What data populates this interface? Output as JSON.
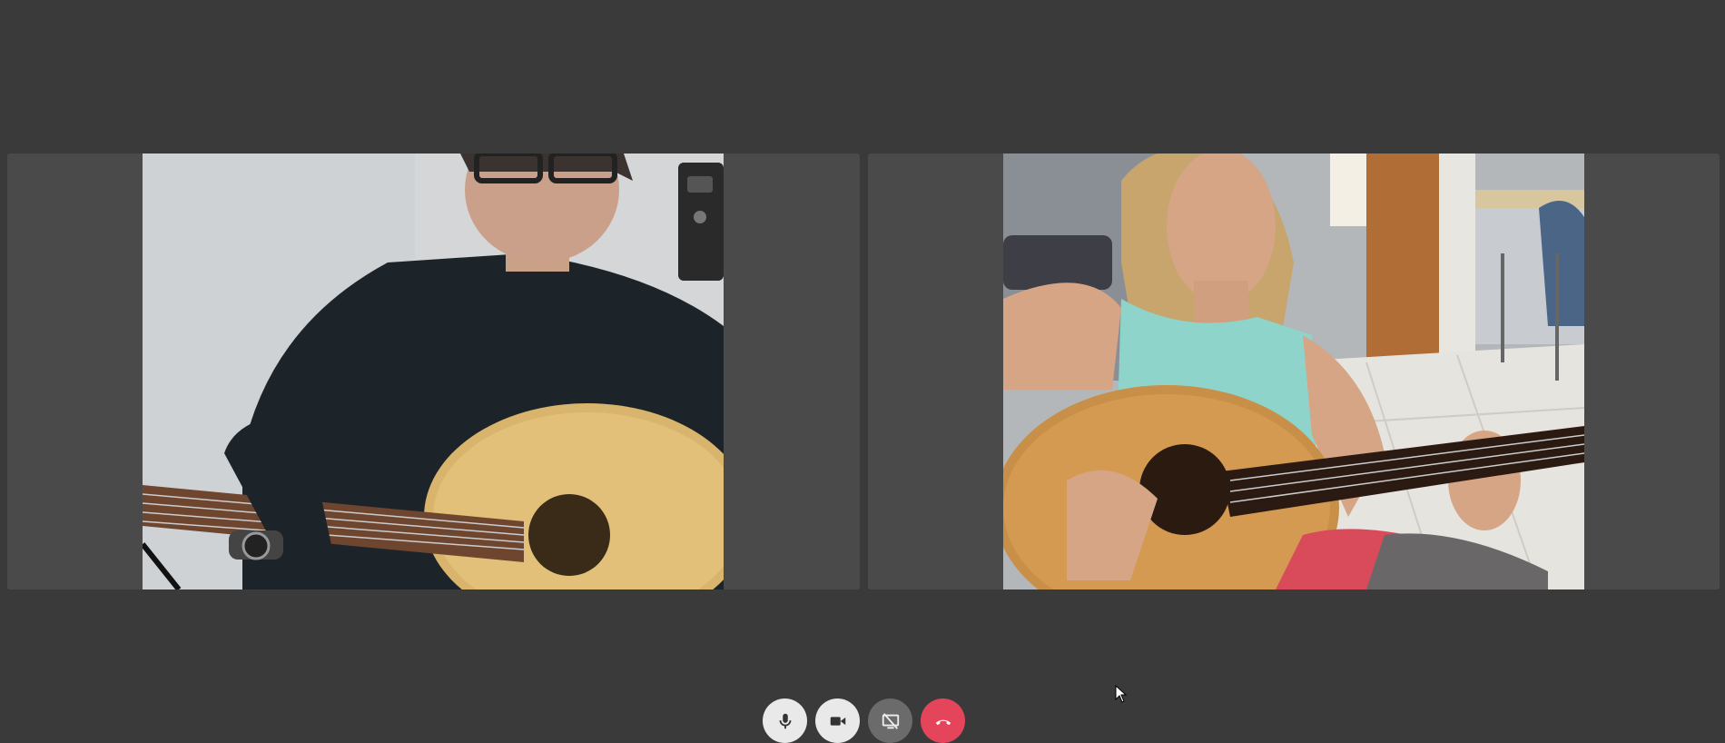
{
  "call": {
    "participants": [
      {
        "video_icon": "camera-feed"
      },
      {
        "video_icon": "camera-feed"
      }
    ],
    "controls": [
      {
        "icon": "microphone-icon",
        "state": "on"
      },
      {
        "icon": "video-camera-icon",
        "state": "on"
      },
      {
        "icon": "screen-share-off-icon",
        "state": "off"
      },
      {
        "icon": "hang-up-icon",
        "state": "end"
      }
    ]
  },
  "colors": {
    "background": "#3a3a3a",
    "tile": "#4a4a4a",
    "control_light": "#e9e9e9",
    "control_dark": "#6b6b6b",
    "hang_up": "#e5455a"
  }
}
